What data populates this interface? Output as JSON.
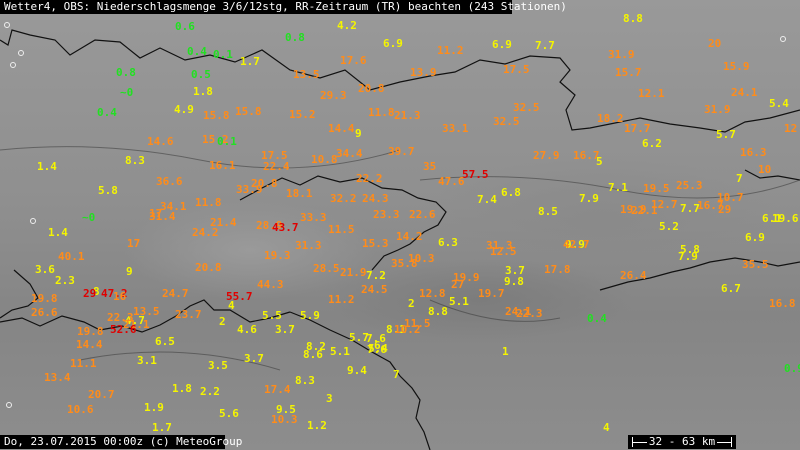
{
  "header": {
    "title": "Wetter4, OBS: Niederschlagsmenge 3/6/12stg, RR-Zeitraum (TR) beachten (243 Stationen)"
  },
  "footer": {
    "timestamp": "Do, 23.07.2015 00:00z (c) MeteoGroup"
  },
  "scale": {
    "label": "32 - 63 km"
  },
  "colors": {
    "green": "#22e022",
    "yellow": "#f5f500",
    "orange": "#ff8c1a",
    "red": "#e00000"
  },
  "stations": [
    {
      "v": "0.6",
      "c": "g"
    },
    {
      "v": "4.2",
      "c": "y"
    },
    {
      "v": "8.8",
      "c": "y"
    },
    {
      "v": "0.4",
      "c": "g"
    },
    {
      "v": "0.1",
      "c": "g"
    },
    {
      "v": "0.8",
      "c": "g"
    },
    {
      "v": "6.9",
      "c": "y"
    },
    {
      "v": "11.2",
      "c": "o"
    },
    {
      "v": "6.9",
      "c": "y"
    },
    {
      "v": "7.7",
      "c": "y"
    },
    {
      "v": "20",
      "c": "o"
    },
    {
      "v": "31.9",
      "c": "o"
    },
    {
      "v": "1.7",
      "c": "y"
    },
    {
      "v": "17.6",
      "c": "o"
    },
    {
      "v": "0.8",
      "c": "g"
    },
    {
      "v": "0.5",
      "c": "g"
    },
    {
      "v": "13.5",
      "c": "o"
    },
    {
      "v": "13.9",
      "c": "o"
    },
    {
      "v": "17.5",
      "c": "o"
    },
    {
      "v": "15.7",
      "c": "o"
    },
    {
      "v": "15.9",
      "c": "o"
    },
    {
      "v": "~0",
      "c": "g"
    },
    {
      "v": "1.8",
      "c": "y"
    },
    {
      "v": "29.3",
      "c": "o"
    },
    {
      "v": "20.8",
      "c": "o"
    },
    {
      "v": "12.1",
      "c": "o"
    },
    {
      "v": "24.1",
      "c": "o"
    },
    {
      "v": "5.4",
      "c": "y"
    },
    {
      "v": "0.4",
      "c": "g"
    },
    {
      "v": "4.9",
      "c": "y"
    },
    {
      "v": "15.8",
      "c": "o"
    },
    {
      "v": "15.8",
      "c": "o"
    },
    {
      "v": "15.2",
      "c": "o"
    },
    {
      "v": "11.8",
      "c": "o"
    },
    {
      "v": "21.3",
      "c": "o"
    },
    {
      "v": "32.5",
      "c": "o"
    },
    {
      "v": "32.5",
      "c": "o"
    },
    {
      "v": "31.9",
      "c": "o"
    },
    {
      "v": "18.2",
      "c": "o"
    },
    {
      "v": "12",
      "c": "o"
    },
    {
      "v": "14.4",
      "c": "o"
    },
    {
      "v": "9",
      "c": "y"
    },
    {
      "v": "33.1",
      "c": "o"
    },
    {
      "v": "17.7",
      "c": "o"
    },
    {
      "v": "5.7",
      "c": "y"
    },
    {
      "v": "14.6",
      "c": "o"
    },
    {
      "v": "15.2",
      "c": "o"
    },
    {
      "v": "0.1",
      "c": "g"
    },
    {
      "v": "6.2",
      "c": "y"
    },
    {
      "v": "16.3",
      "c": "o"
    },
    {
      "v": "8.3",
      "c": "y"
    },
    {
      "v": "17.5",
      "c": "o"
    },
    {
      "v": "10.8",
      "c": "o"
    },
    {
      "v": "34.4",
      "c": "o"
    },
    {
      "v": "39.7",
      "c": "o"
    },
    {
      "v": "27.9",
      "c": "o"
    },
    {
      "v": "16.7",
      "c": "o"
    },
    {
      "v": "5",
      "c": "y"
    },
    {
      "v": "1.4",
      "c": "y"
    },
    {
      "v": "16.1",
      "c": "o"
    },
    {
      "v": "22.4",
      "c": "o"
    },
    {
      "v": "35",
      "c": "o"
    },
    {
      "v": "57.5",
      "c": "r"
    },
    {
      "v": "10",
      "c": "o"
    },
    {
      "v": "36.6",
      "c": "o"
    },
    {
      "v": "20.8",
      "c": "o"
    },
    {
      "v": "22.2",
      "c": "o"
    },
    {
      "v": "47.6",
      "c": "o"
    },
    {
      "v": "7",
      "c": "y"
    },
    {
      "v": "5.8",
      "c": "y"
    },
    {
      "v": "33.9",
      "c": "o"
    },
    {
      "v": "18.1",
      "c": "o"
    },
    {
      "v": "6.8",
      "c": "y"
    },
    {
      "v": "7.1",
      "c": "y"
    },
    {
      "v": "19.5",
      "c": "o"
    },
    {
      "v": "25.3",
      "c": "o"
    },
    {
      "v": "10.7",
      "c": "o"
    },
    {
      "v": "34.1",
      "c": "o"
    },
    {
      "v": "11.8",
      "c": "o"
    },
    {
      "v": "32.2",
      "c": "o"
    },
    {
      "v": "24.3",
      "c": "o"
    },
    {
      "v": "7.4",
      "c": "y"
    },
    {
      "v": "7.9",
      "c": "y"
    },
    {
      "v": "17",
      "c": "o"
    },
    {
      "v": "19.9",
      "c": "o"
    },
    {
      "v": "22.1",
      "c": "o"
    },
    {
      "v": "12.7",
      "c": "o"
    },
    {
      "v": "7.7",
      "c": "y"
    },
    {
      "v": "16.7",
      "c": "o"
    },
    {
      "v": "29",
      "c": "o"
    },
    {
      "v": "~0",
      "c": "g"
    },
    {
      "v": "31.4",
      "c": "o"
    },
    {
      "v": "33.3",
      "c": "o"
    },
    {
      "v": "23.3",
      "c": "o"
    },
    {
      "v": "22.6",
      "c": "o"
    },
    {
      "v": "8.5",
      "c": "y"
    },
    {
      "v": "6.1",
      "c": "y"
    },
    {
      "v": "19.6",
      "c": "y"
    },
    {
      "v": "21.4",
      "c": "o"
    },
    {
      "v": "28.9",
      "c": "o"
    },
    {
      "v": "43.7",
      "c": "r"
    },
    {
      "v": "11.5",
      "c": "o"
    },
    {
      "v": "5.2",
      "c": "y"
    },
    {
      "v": "1.4",
      "c": "y"
    },
    {
      "v": "24.2",
      "c": "o"
    },
    {
      "v": "15.3",
      "c": "o"
    },
    {
      "v": "14.2",
      "c": "o"
    },
    {
      "v": "9.9",
      "c": "y"
    },
    {
      "v": "6.9",
      "c": "y"
    },
    {
      "v": "17",
      "c": "o"
    },
    {
      "v": "6.3",
      "c": "y"
    },
    {
      "v": "31.3",
      "c": "o"
    },
    {
      "v": "42.7",
      "c": "o"
    },
    {
      "v": "40.1",
      "c": "o"
    },
    {
      "v": "31.3",
      "c": "o"
    },
    {
      "v": "19.3",
      "c": "o"
    },
    {
      "v": "12.5",
      "c": "o"
    },
    {
      "v": "5.8",
      "c": "y"
    },
    {
      "v": "35.8",
      "c": "o"
    },
    {
      "v": "10.3",
      "c": "o"
    },
    {
      "v": "7.9",
      "c": "y"
    },
    {
      "v": "3.6",
      "c": "y"
    },
    {
      "v": "20.8",
      "c": "o"
    },
    {
      "v": "28.5",
      "c": "o"
    },
    {
      "v": "21.9",
      "c": "o"
    },
    {
      "v": "7.2",
      "c": "y"
    },
    {
      "v": "3.7",
      "c": "y"
    },
    {
      "v": "17.8",
      "c": "o"
    },
    {
      "v": "35.5",
      "c": "o"
    },
    {
      "v": "9",
      "c": "y"
    },
    {
      "v": "19.9",
      "c": "o"
    },
    {
      "v": "26.4",
      "c": "o"
    },
    {
      "v": "2.3",
      "c": "y"
    },
    {
      "v": "9.8",
      "c": "y"
    },
    {
      "v": "27",
      "c": "o"
    },
    {
      "v": "44.3",
      "c": "o"
    },
    {
      "v": "24.5",
      "c": "o"
    },
    {
      "v": "6.7",
      "c": "y"
    },
    {
      "v": "8",
      "c": "y"
    },
    {
      "v": "47.2",
      "c": "r"
    },
    {
      "v": "29",
      "c": "r"
    },
    {
      "v": "16",
      "c": "o"
    },
    {
      "v": "24.7",
      "c": "o"
    },
    {
      "v": "55.7",
      "c": "r"
    },
    {
      "v": "12.8",
      "c": "o"
    },
    {
      "v": "19.7",
      "c": "o"
    },
    {
      "v": "19.8",
      "c": "o"
    },
    {
      "v": "11.2",
      "c": "o"
    },
    {
      "v": "5.1",
      "c": "y"
    },
    {
      "v": "16.8",
      "c": "o"
    },
    {
      "v": "4",
      "c": "y"
    },
    {
      "v": "2",
      "c": "y"
    },
    {
      "v": "8.8",
      "c": "y"
    },
    {
      "v": "24.1",
      "c": "o"
    },
    {
      "v": "22.3",
      "c": "o"
    },
    {
      "v": "26.6",
      "c": "o"
    },
    {
      "v": "13.5",
      "c": "o"
    },
    {
      "v": "23.7",
      "c": "o"
    },
    {
      "v": "2",
      "c": "y"
    },
    {
      "v": "5.5",
      "c": "y"
    },
    {
      "v": "5.9",
      "c": "y"
    },
    {
      "v": "4.7",
      "c": "y"
    },
    {
      "v": "22.3",
      "c": "o"
    },
    {
      "v": "21.1",
      "c": "o"
    },
    {
      "v": "0.4",
      "c": "g"
    },
    {
      "v": "4.6",
      "c": "y"
    },
    {
      "v": "3.7",
      "c": "y"
    },
    {
      "v": "11.5",
      "c": "o"
    },
    {
      "v": "19.8",
      "c": "o"
    },
    {
      "v": "52.6",
      "c": "r"
    },
    {
      "v": "5.7",
      "c": "y"
    },
    {
      "v": "7.6",
      "c": "y"
    },
    {
      "v": "8.1",
      "c": "y"
    },
    {
      "v": "10.2",
      "c": "o"
    },
    {
      "v": "6.5",
      "c": "y"
    },
    {
      "v": "14.4",
      "c": "o"
    },
    {
      "v": "8.2",
      "c": "y"
    },
    {
      "v": "5.4",
      "c": "y"
    },
    {
      "v": "6",
      "c": "y"
    },
    {
      "v": "8.6",
      "c": "y"
    },
    {
      "v": "5.1",
      "c": "y"
    },
    {
      "v": "1",
      "c": "y"
    },
    {
      "v": "3.1",
      "c": "y"
    },
    {
      "v": "11.1",
      "c": "o"
    },
    {
      "v": "3.5",
      "c": "y"
    },
    {
      "v": "3.7",
      "c": "y"
    },
    {
      "v": "9.4",
      "c": "y"
    },
    {
      "v": "0.9",
      "c": "g"
    },
    {
      "v": "13.4",
      "c": "o"
    },
    {
      "v": "7",
      "c": "y"
    },
    {
      "v": "8.3",
      "c": "y"
    },
    {
      "v": "1.8",
      "c": "y"
    },
    {
      "v": "2.2",
      "c": "y"
    },
    {
      "v": "17.4",
      "c": "o"
    },
    {
      "v": "20.7",
      "c": "o"
    },
    {
      "v": "3",
      "c": "y"
    },
    {
      "v": "10.6",
      "c": "o"
    },
    {
      "v": "1.9",
      "c": "y"
    },
    {
      "v": "5.6",
      "c": "y"
    },
    {
      "v": "9.5",
      "c": "y"
    },
    {
      "v": "10.3",
      "c": "o"
    },
    {
      "v": "1.7",
      "c": "y"
    },
    {
      "v": "1.2",
      "c": "y"
    },
    {
      "v": "4",
      "c": "y"
    },
    {
      "v": "7.6",
      "c": "y"
    }
  ]
}
